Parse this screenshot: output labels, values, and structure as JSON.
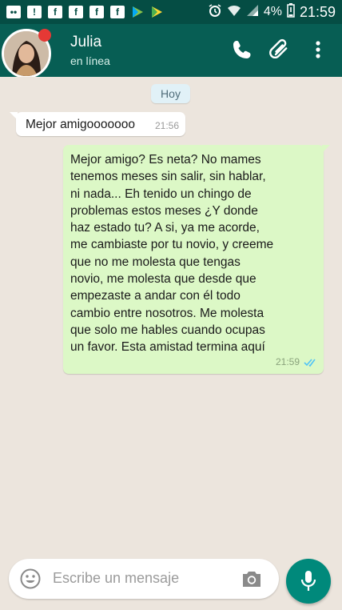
{
  "status_bar": {
    "battery_percent": "4%",
    "time": "21:59",
    "left_icons": [
      "chat-icon",
      "alert-icon",
      "facebook-icon",
      "facebook-icon",
      "facebook-icon",
      "facebook-icon",
      "play-store-icon",
      "play-store-icon"
    ],
    "right_icons": [
      "alarm-icon",
      "wifi-icon",
      "signal-icon",
      "battery-low-icon"
    ]
  },
  "header": {
    "contact_name": "Julia",
    "contact_status": "en línea",
    "icons": [
      "back-arrow-icon",
      "phone-icon",
      "attach-icon",
      "more-icon"
    ],
    "colors": {
      "status_bar": "#054d44",
      "app_bar": "#075e54"
    }
  },
  "chat": {
    "date_label": "Hoy",
    "messages": [
      {
        "direction": "incoming",
        "text": "Mejor amigooooooo",
        "time": "21:56"
      },
      {
        "direction": "outgoing",
        "text": "Mejor amigo? Es neta? No mames tenemos meses sin salir, sin hablar, ni nada...  Eh tenido un chingo de problemas estos meses ¿Y donde haz estado tu? A si, ya me acorde, me cambiaste por tu novio, y creeme que no me molesta que tengas novio, me molesta que desde que empezaste a andar con él todo cambio entre nosotros. Me molesta que solo me hables cuando ocupas un favor. Esta amistad termina aquí",
        "time": "21:59",
        "status": "read"
      }
    ],
    "colors": {
      "background": "#ece5dd",
      "incoming": "#ffffff",
      "outgoing": "#dcf8c6",
      "read_ticks": "#4fc3f7"
    }
  },
  "composer": {
    "placeholder": "Escribe un mensaje",
    "icons": [
      "emoji-icon",
      "camera-icon",
      "mic-icon"
    ],
    "mic_color": "#00897b"
  }
}
